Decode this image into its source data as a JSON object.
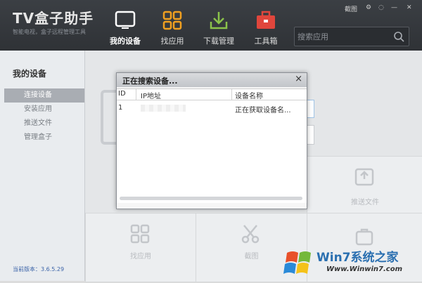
{
  "app": {
    "title": "TV盒子助手",
    "subtitle": "智能电视，盒子远程管理工具",
    "win_controls": [
      "截图",
      "⚙",
      "◌",
      "—",
      "✕"
    ]
  },
  "nav": [
    {
      "label": "我的设备",
      "icon": "tv-icon"
    },
    {
      "label": "找应用",
      "icon": "grid-icon"
    },
    {
      "label": "下载管理",
      "icon": "download-icon"
    },
    {
      "label": "工具箱",
      "icon": "toolbox-icon"
    }
  ],
  "search": {
    "placeholder": "搜索应用"
  },
  "sidebar": {
    "title": "我的设备",
    "items": [
      {
        "label": "连接设备"
      },
      {
        "label": "安装应用"
      },
      {
        "label": "推送文件"
      },
      {
        "label": "管理盒子"
      }
    ],
    "version": "当前版本：3.6.5.29"
  },
  "tiles": {
    "push_file": "推送文件",
    "find_app": "找应用",
    "screenshot": "截图"
  },
  "dialog": {
    "title": "正在搜索设备...",
    "columns": [
      "ID",
      "IP地址",
      "设备名称"
    ],
    "rows": [
      {
        "id": "1",
        "ip": "",
        "name": "正在获取设备名..."
      }
    ]
  },
  "watermark": {
    "brand": "Win7系统之家",
    "url": "Www.Winwin7.com"
  },
  "colors": {
    "topbar": "#33363a",
    "accent_green": "#8bc34a",
    "accent_orange": "#f0a020",
    "accent_red": "#e0463c"
  }
}
